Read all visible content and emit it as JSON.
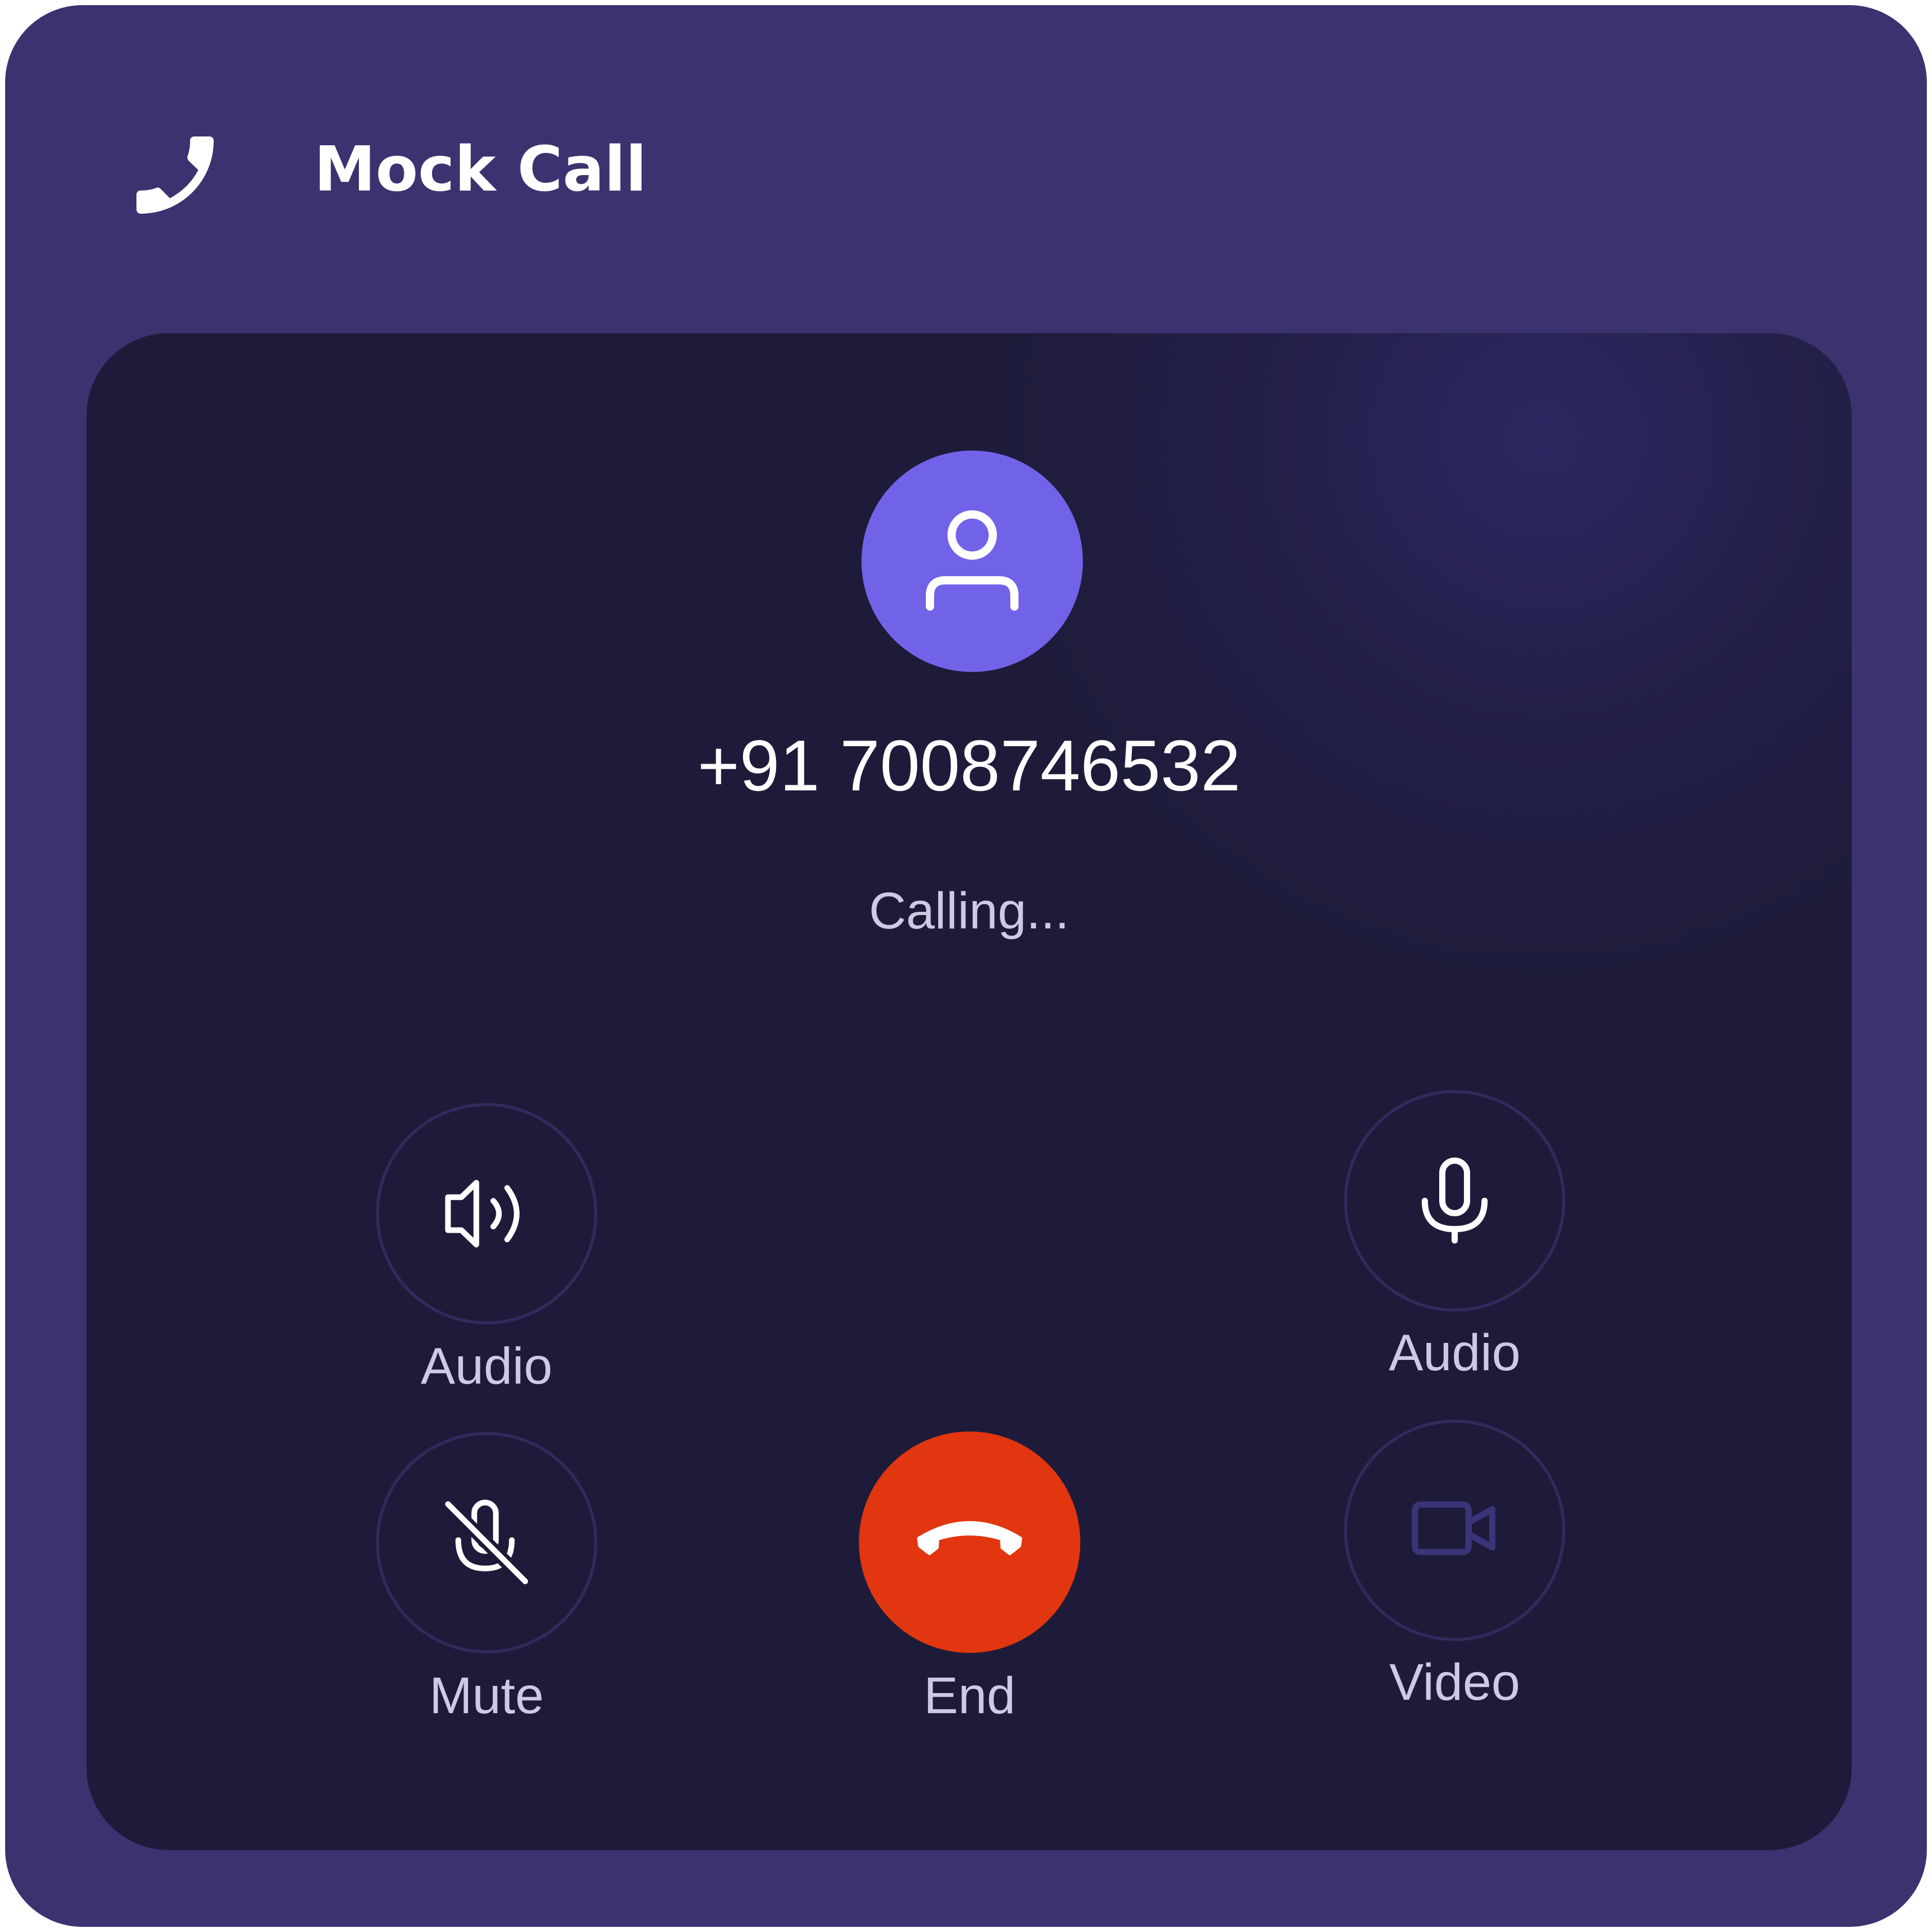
{
  "header": {
    "title": "Mock Call",
    "icon": "phone-icon"
  },
  "call": {
    "phone_number": "+91 7008746532",
    "status": "Calling...",
    "avatar_icon": "user-icon"
  },
  "controls": {
    "speaker": {
      "label": "Audio",
      "icon": "speaker-icon"
    },
    "microphone": {
      "label": "Audio",
      "icon": "microphone-icon"
    },
    "mute": {
      "label": "Mute",
      "icon": "microphone-off-icon"
    },
    "end": {
      "label": "End",
      "icon": "hang-up-icon"
    },
    "video": {
      "label": "Video",
      "icon": "video-camera-icon"
    }
  },
  "colors": {
    "frame_background": "#3b3270",
    "panel_background": "#1e1b3a",
    "avatar_background": "#7163e8",
    "end_button": "#e1360f",
    "label_text": "#cfc9e4",
    "video_icon_disabled": "#3a3478"
  }
}
